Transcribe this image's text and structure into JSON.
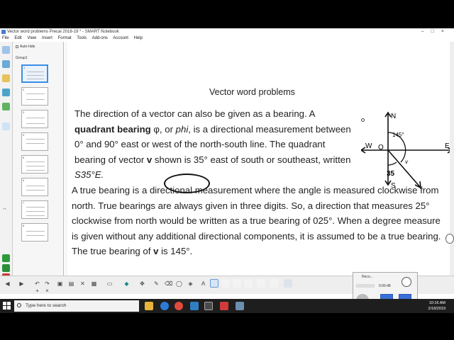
{
  "window": {
    "title": "Vector word problems Precal 2018-19 * - SMART Notebook",
    "controls": [
      "–",
      "□",
      "×"
    ]
  },
  "menu": [
    "File",
    "Edit",
    "View",
    "Insert",
    "Format",
    "Tools",
    "Add-ons",
    "Account",
    "Help"
  ],
  "sorter": {
    "auto_hide": "Auto-hide",
    "group": "Group1",
    "thumbnails": [
      "1",
      "2",
      "3",
      "4",
      "5",
      "6",
      "7",
      "8"
    ]
  },
  "slide": {
    "heading": "Vector word problems",
    "p1_a": "The direction of a vector can also be given as a bearing.  A ",
    "p1_bold": "quadrant bearing",
    "p1_b": " φ, or ",
    "p1_phi": "phi",
    "p1_c": ", is a directional measurement between 0° and 90° east or west of the north-south line.  The quadrant bearing of vector ",
    "p1_v": "v",
    "p1_d": " shown is 35° east of south or southeast, written ",
    "notation": "S35°E.",
    "p2_a": "A true bearing is a directional measurement where the angle is measured clockwise from north.  True bearings are always given in three digits.  So, a direction that measures 25° clockwise from north would be written as a true bearing of 025°.  When a degree measure is given without any additional directional components, it is assumed to be a true bearing.  The true bearing of ",
    "p2_v": "v",
    "p2_b": " is 145°."
  },
  "compass": {
    "n": "N",
    "s": "S",
    "e": "E",
    "w": "W",
    "o": "O",
    "angle": "145°",
    "v": "v",
    "hand_angle": "35"
  },
  "recorder": {
    "title": "Reco...",
    "time": "0:06:48"
  },
  "taskbar": {
    "search_placeholder": "Type here to search",
    "time": "10:16 AM",
    "date": "2/18/2019"
  }
}
